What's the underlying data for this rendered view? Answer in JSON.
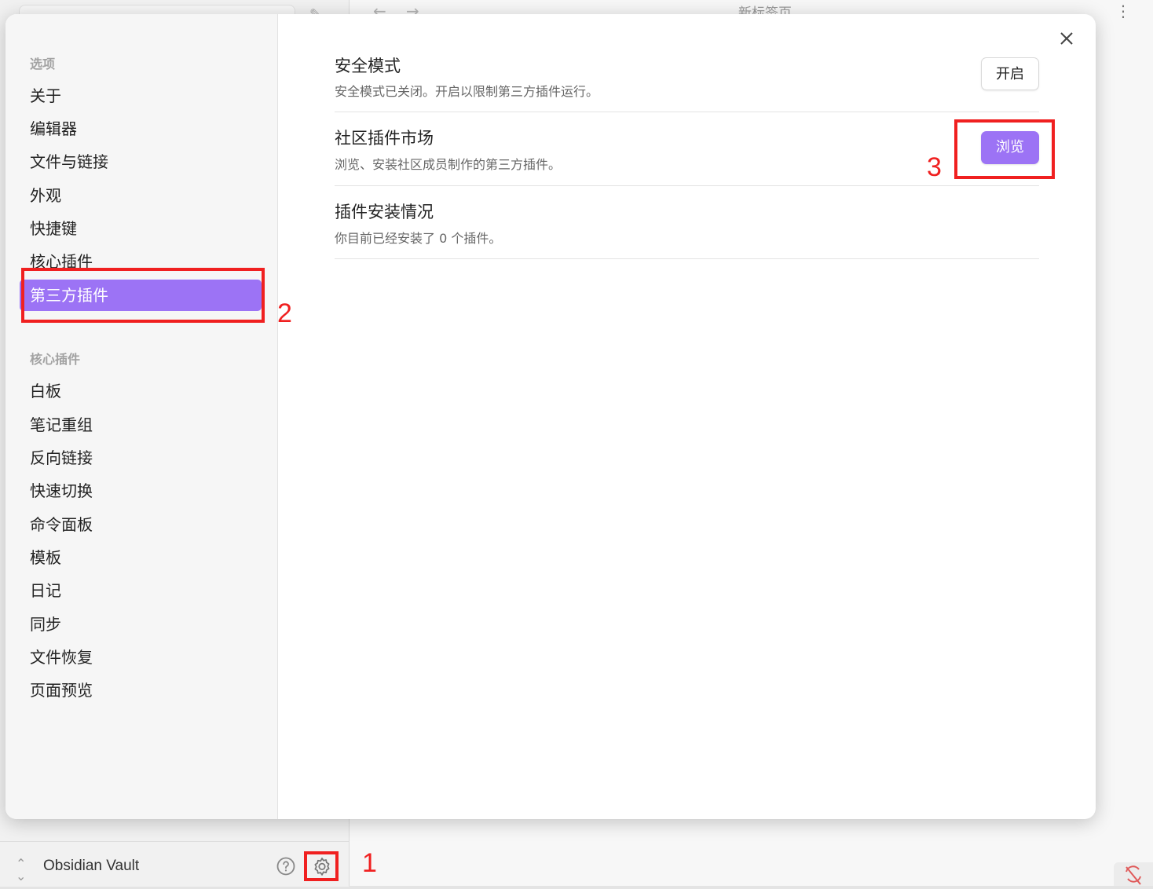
{
  "background": {
    "tab_title": "新标签页",
    "nav_back": "←",
    "nav_forward": "→",
    "more_icon": "more-vertical-icon",
    "vault_name": "Obsidian Vault"
  },
  "sidebar": {
    "options_header": "选项",
    "options": [
      "关于",
      "编辑器",
      "文件与链接",
      "外观",
      "快捷键",
      "核心插件",
      "第三方插件"
    ],
    "active_item": "第三方插件",
    "core_header": "核心插件",
    "core_plugins": [
      "白板",
      "笔记重组",
      "反向链接",
      "快速切换",
      "命令面板",
      "模板",
      "日记",
      "同步",
      "文件恢复",
      "页面预览"
    ]
  },
  "settings": [
    {
      "title": "安全模式",
      "description": "安全模式已关闭。开启以限制第三方插件运行。",
      "button": "开启",
      "button_style": "default"
    },
    {
      "title": "社区插件市场",
      "description": "浏览、安装社区成员制作的第三方插件。",
      "button": "浏览",
      "button_style": "primary"
    },
    {
      "title": "插件安装情况",
      "description": "你目前已经安装了 0 个插件。"
    }
  ],
  "annotations": {
    "step1": "1",
    "step2": "2",
    "step3": "3"
  },
  "colors": {
    "accent": "#9c73f5",
    "annotation": "#f02020"
  }
}
